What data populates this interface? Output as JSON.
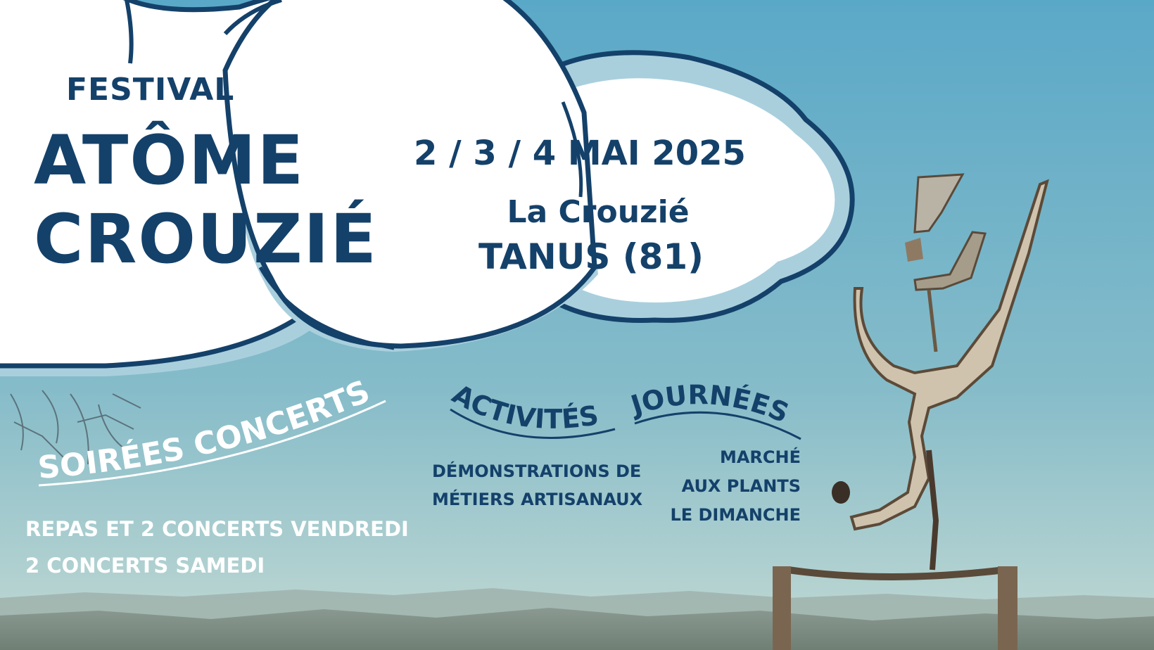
{
  "colors": {
    "navy": "#14416a",
    "sky_top": "#5fa9c8",
    "sky_bottom": "#b9d6d6",
    "cloud": "#ffffff",
    "cloud_shadow": "#a9cfdd"
  },
  "header": {
    "festival": "FESTIVAL",
    "title_line1": "ATÔME",
    "title_line2": "CROUZIÉ"
  },
  "event": {
    "dates": "2 / 3 / 4 MAI 2025",
    "place_line1": "La Crouzié",
    "place_line2": "TANUS (81)"
  },
  "sections": {
    "soirees": {
      "heading": "SOIRÉES CONCERTS",
      "lines": [
        "REPAS ET 2 CONCERTS VENDREDI",
        "2 CONCERTS SAMEDI"
      ]
    },
    "activites": {
      "heading": "ACTIVITÉS",
      "lines": [
        "DÉMONSTRATIONS DE",
        "MÉTIERS ARTISANAUX"
      ]
    },
    "journees": {
      "heading": "JOURNÉES",
      "lines": [
        "MARCHÉ",
        "AUX PLANTS",
        "LE DIMANCHE"
      ]
    }
  }
}
